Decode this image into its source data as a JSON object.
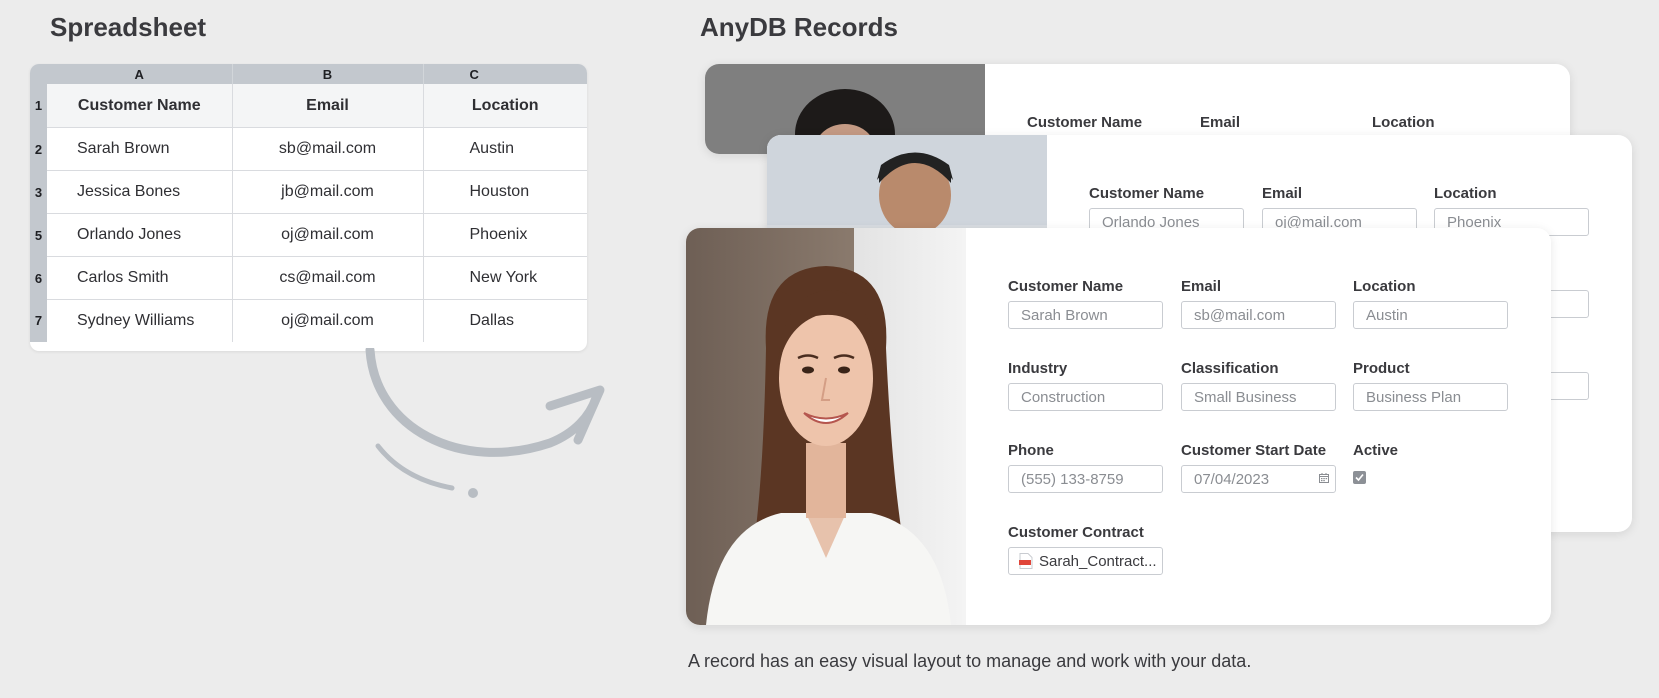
{
  "spreadsheet": {
    "title": "Spreadsheet",
    "column_letters": [
      "A",
      "B",
      "C"
    ],
    "header_row_number": "1",
    "headers": [
      "Customer Name",
      "Email",
      "Location"
    ],
    "rows": [
      {
        "num": "2",
        "name": "Sarah Brown",
        "email": "sb@mail.com",
        "location": "Austin"
      },
      {
        "num": "3",
        "name": "Jessica Bones",
        "email": "jb@mail.com",
        "location": "Houston"
      },
      {
        "num": "5",
        "name": "Orlando Jones",
        "email": "oj@mail.com",
        "location": "Phoenix"
      },
      {
        "num": "6",
        "name": "Carlos Smith",
        "email": "cs@mail.com",
        "location": "New York"
      },
      {
        "num": "7",
        "name": "Sydney Williams",
        "email": "oj@mail.com",
        "location": "Dallas"
      }
    ]
  },
  "records": {
    "title": "AnyDB Records",
    "back_card": {
      "labels": {
        "name": "Customer Name",
        "email": "Email",
        "location": "Location"
      }
    },
    "middle_card": {
      "labels": {
        "name": "Customer Name",
        "email": "Email",
        "location": "Location"
      },
      "values": {
        "name": "Orlando Jones",
        "email": "oj@mail.com",
        "location": "Phoenix"
      }
    },
    "front_card": {
      "fields": {
        "customer_name": {
          "label": "Customer Name",
          "value": "Sarah Brown"
        },
        "email": {
          "label": "Email",
          "value": "sb@mail.com"
        },
        "location": {
          "label": "Location",
          "value": "Austin"
        },
        "industry": {
          "label": "Industry",
          "value": "Construction"
        },
        "classification": {
          "label": "Classification",
          "value": "Small Business"
        },
        "product": {
          "label": "Product",
          "value": "Business Plan"
        },
        "phone": {
          "label": "Phone",
          "value": "(555) 133-8759"
        },
        "start_date": {
          "label": "Customer Start Date",
          "value": "07/04/2023"
        },
        "active": {
          "label": "Active",
          "checked": true
        },
        "contract": {
          "label": "Customer Contract",
          "file": "Sarah_Contract..."
        }
      }
    }
  },
  "caption": "A record has an easy visual layout to manage and work with your data.",
  "colors": {
    "background": "#ececec",
    "sheet_header": "#c3c8ce",
    "arrow": "#b8bdc3",
    "pdf_red": "#e0463a"
  }
}
